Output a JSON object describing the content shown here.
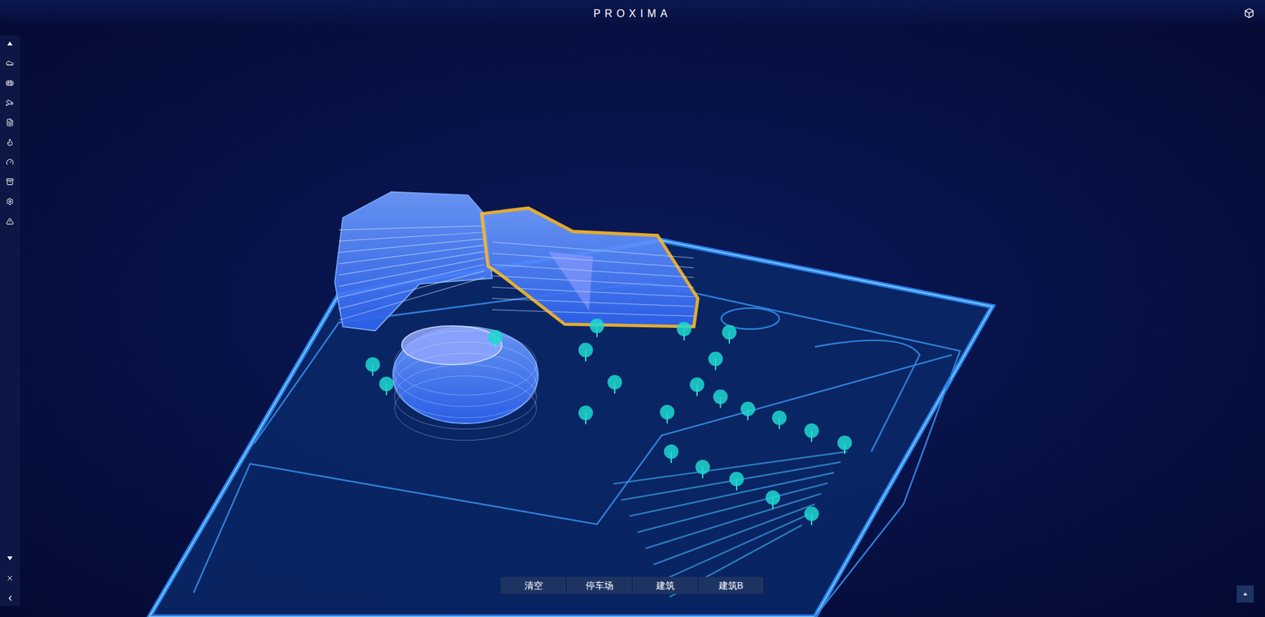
{
  "header": {
    "title": "PROXIMA"
  },
  "toolbar": {
    "buttons": [
      {
        "label": "清空",
        "selected": false
      },
      {
        "label": "停车场",
        "selected": false
      },
      {
        "label": "建筑",
        "selected": false
      },
      {
        "label": "建筑B",
        "selected": false
      }
    ]
  },
  "scene": {
    "buildings": [
      {
        "selected": false
      },
      {
        "selected": true
      },
      {
        "selected": false
      }
    ]
  }
}
